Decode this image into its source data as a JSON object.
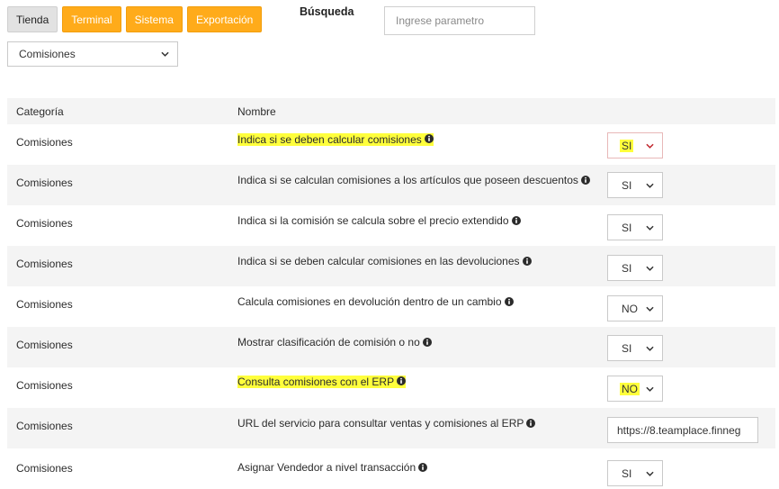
{
  "tabs": [
    {
      "label": "Tienda",
      "active": true
    },
    {
      "label": "Terminal",
      "active": false
    },
    {
      "label": "Sistema",
      "active": false
    },
    {
      "label": "Exportación",
      "active": false
    }
  ],
  "search": {
    "label": "Búsqueda",
    "placeholder": "Ingrese parametro",
    "value": ""
  },
  "filter": {
    "selected": "Comisiones"
  },
  "table": {
    "headers": {
      "category": "Categoría",
      "name": "Nombre"
    },
    "rows": [
      {
        "category": "Comisiones",
        "name": "Indica si se deben calcular comisiones",
        "value": "SI",
        "highlighted": true
      },
      {
        "category": "Comisiones",
        "name": "Indica si se calculan comisiones a los artículos que poseen descuentos",
        "value": "SI",
        "highlighted": false
      },
      {
        "category": "Comisiones",
        "name": "Indica si la comisión se calcula sobre el precio extendido",
        "value": "SI",
        "highlighted": false
      },
      {
        "category": "Comisiones",
        "name": "Indica si se deben calcular comisiones en las devoluciones",
        "value": "SI",
        "highlighted": false
      },
      {
        "category": "Comisiones",
        "name": "Calcula comisiones en devolución dentro de un cambio",
        "value": "NO",
        "highlighted": false
      },
      {
        "category": "Comisiones",
        "name": "Mostrar clasificación de comisión o no",
        "value": "SI",
        "highlighted": false
      },
      {
        "category": "Comisiones",
        "name": "Consulta comisiones con el ERP",
        "value": "NO",
        "highlighted": true
      },
      {
        "category": "Comisiones",
        "name": "URL del servicio para consultar ventas y comisiones al ERP",
        "value": "https://8.teamplace.finneg",
        "highlighted": false
      },
      {
        "category": "Comisiones",
        "name": "Asignar Vendedor a nivel transacción",
        "value": "SI",
        "highlighted": false
      }
    ]
  },
  "icons": {
    "info": "info-circle-icon",
    "dropdown": "chevron-down-icon"
  },
  "colors": {
    "tab_orange": "#ffab1a",
    "highlight": "#ffff3c",
    "chevron_red": "#c0262d"
  }
}
